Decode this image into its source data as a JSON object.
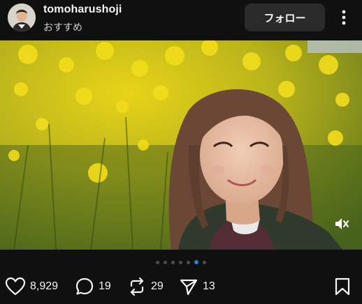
{
  "header": {
    "username": "tomoharushoji",
    "subtitle": "おすすめ",
    "follow_label": "フォロー"
  },
  "media": {
    "description_icon": "mute-icon",
    "carousel": {
      "count": 6,
      "active_index": 5
    }
  },
  "actions": {
    "likes": "8,929",
    "comments": "19",
    "reposts": "29",
    "shares": "13"
  },
  "colors": {
    "background": "#101010",
    "follow_button": "#2a2a2a",
    "active_dot": "#2f7de1"
  }
}
